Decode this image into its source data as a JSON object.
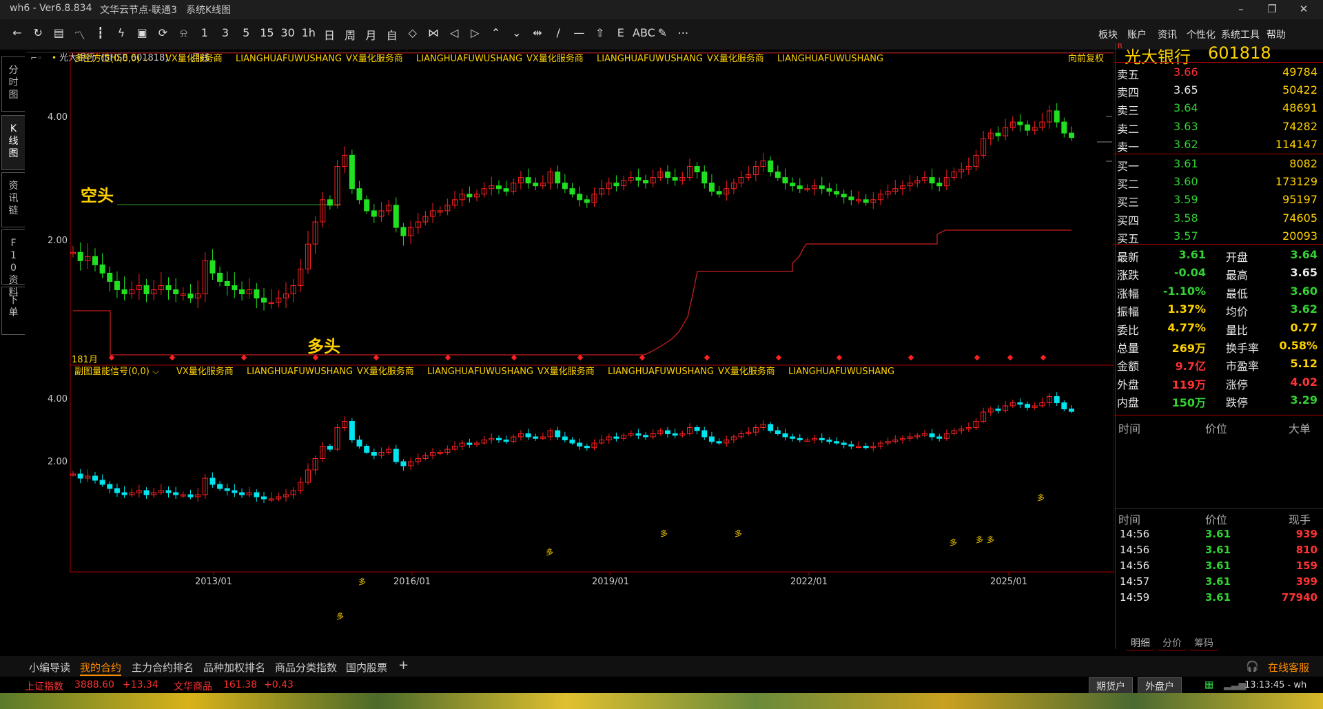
{
  "window": {
    "title": "wh6 - Ver6.8.834",
    "server": "文华云节点-联通3",
    "subtitle": "系统K线图"
  },
  "toolbar": {
    "tools": [
      "←",
      "↻",
      "▤",
      "〽",
      "┇",
      "ϟ",
      "▣",
      "⟳",
      "⍾",
      "1",
      "3",
      "5",
      "15",
      "30",
      "1h",
      "日",
      "周",
      "月",
      "自",
      "◇",
      "⋈",
      "◁",
      "▷",
      "⌃",
      "⌄",
      "⇹",
      "∕",
      "—",
      "⇧",
      "Ε",
      "ABC",
      "✎",
      "⋯"
    ],
    "menus": [
      "板块",
      "账户",
      "资讯",
      "个性化",
      "系统工具",
      "帮助"
    ]
  },
  "left_tabs": [
    "分时图",
    "K线图",
    "资讯链",
    "F10资料",
    "下单"
  ],
  "main_chart": {
    "instrument": "光大银行",
    "superscript": "R",
    "symbol_code": "(SHSE 601818)",
    "period": "月线",
    "indicator_label": "多空方位(0,0,0)",
    "vx": "VX量化服务商",
    "lh": "LIANGHUAFUWUSHANG",
    "adjust_label": "向前复权",
    "bear_label": "空头",
    "bull_label": "多头",
    "count_label": "181月",
    "y_ticks": [
      "4.00",
      "2.00"
    ]
  },
  "sub_chart": {
    "indicator_label": "副图量能信号(0,0)",
    "y_ticks": [
      "4.00",
      "2.00"
    ],
    "signal": "多"
  },
  "x_axis": [
    "2013/01",
    "2016/01",
    "2019/01",
    "2022/01",
    "2025/01"
  ],
  "quote": {
    "superscript": "R",
    "name": "光大银行",
    "code": "601818",
    "asks": [
      {
        "label": "卖五",
        "price": "3.66",
        "vol": "49784"
      },
      {
        "label": "卖四",
        "price": "3.65",
        "vol": "50422"
      },
      {
        "label": "卖三",
        "price": "3.64",
        "vol": "48691"
      },
      {
        "label": "卖二",
        "price": "3.63",
        "vol": "74282"
      },
      {
        "label": "卖一",
        "price": "3.62",
        "vol": "114147"
      }
    ],
    "bids": [
      {
        "label": "买一",
        "price": "3.61",
        "vol": "8082"
      },
      {
        "label": "买二",
        "price": "3.60",
        "vol": "173129"
      },
      {
        "label": "买三",
        "price": "3.59",
        "vol": "95197"
      },
      {
        "label": "买四",
        "price": "3.58",
        "vol": "74605"
      },
      {
        "label": "买五",
        "price": "3.57",
        "vol": "20093"
      }
    ],
    "stats": [
      {
        "l1": "最新",
        "v1": "3.61",
        "c1": "g",
        "l2": "开盘",
        "v2": "3.64",
        "c2": "g"
      },
      {
        "l1": "涨跌",
        "v1": "-0.04",
        "c1": "g",
        "l2": "最高",
        "v2": "3.65",
        "c2": "w"
      },
      {
        "l1": "涨幅",
        "v1": "-1.10%",
        "c1": "g",
        "l2": "最低",
        "v2": "3.60",
        "c2": "g"
      },
      {
        "l1": "振幅",
        "v1": "1.37%",
        "c1": "y",
        "l2": "均价",
        "v2": "3.62",
        "c2": "g"
      },
      {
        "l1": "委比",
        "v1": "4.77%",
        "c1": "y",
        "l2": "量比",
        "v2": "0.77",
        "c2": "y"
      },
      {
        "l1": "总量",
        "v1": "269万",
        "c1": "y",
        "l2": "换手率",
        "v2": "0.58%",
        "c2": "y"
      },
      {
        "l1": "金额",
        "v1": "9.7亿",
        "c1": "r",
        "l2": "市盈率",
        "v2": "5.12",
        "c2": "y"
      },
      {
        "l1": "外盘",
        "v1": "119万",
        "c1": "r",
        "l2": "涨停",
        "v2": "4.02",
        "c2": "r"
      },
      {
        "l1": "内盘",
        "v1": "150万",
        "c1": "g",
        "l2": "跌停",
        "v2": "3.29",
        "c2": "g"
      }
    ],
    "big_header": {
      "time": "时间",
      "price": "价位",
      "big": "大单"
    },
    "tick_header": {
      "time": "时间",
      "price": "价位",
      "vol": "现手"
    },
    "ticks": [
      {
        "time": "14:56",
        "price": "3.61",
        "vol": "939"
      },
      {
        "time": "14:56",
        "price": "3.61",
        "vol": "810"
      },
      {
        "time": "14:56",
        "price": "3.61",
        "vol": "159"
      },
      {
        "time": "14:57",
        "price": "3.61",
        "vol": "399"
      },
      {
        "time": "14:59",
        "price": "3.61",
        "vol": "77940"
      }
    ],
    "tabs": [
      "明细",
      "分价",
      "筹码"
    ]
  },
  "bottom_tabs": [
    "小编导读",
    "我的合约",
    "主力合约排名",
    "品种加权排名",
    "商品分类指数",
    "国内股票"
  ],
  "add_tab": "+",
  "service": "在线客服",
  "status": {
    "idx1_name": "上证指数",
    "idx1_val": "3888.60",
    "idx1_chg": "+13.34",
    "idx2_name": "文华商品",
    "idx2_val": "161.38",
    "idx2_chg": "+0.43",
    "btn1": "期货户",
    "btn2": "外盘户",
    "clock": "13:13:45 - wh"
  }
}
